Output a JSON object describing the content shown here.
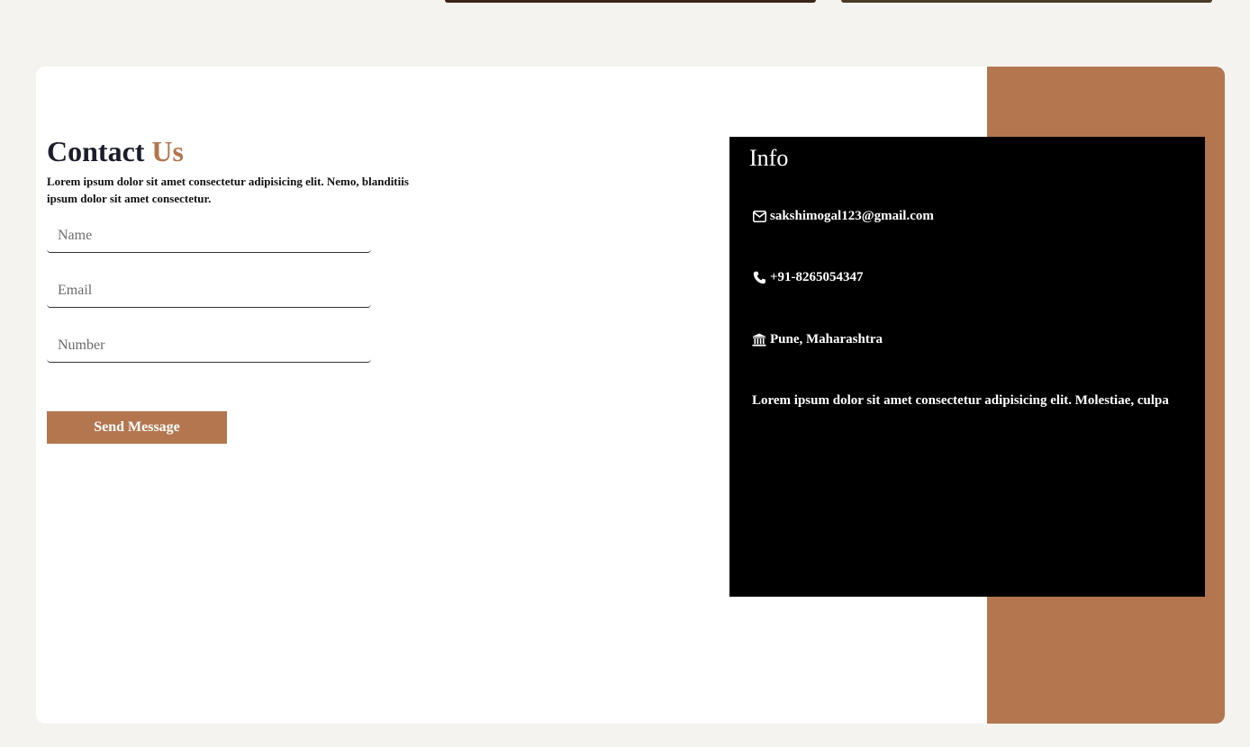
{
  "contact": {
    "title_main": "Contact",
    "title_accent": "Us",
    "subtitle": "Lorem ipsum dolor sit amet consectetur adipisicing elit. Nemo, blanditiis ipsum dolor sit amet consectetur.",
    "name_placeholder": "Name",
    "email_placeholder": "Email",
    "number_placeholder": "Number",
    "send_label": "Send Message"
  },
  "info": {
    "title": "Info",
    "email": "sakshimogal123@gmail.com",
    "phone": "+91-8265054347",
    "location": "Pune, Maharashtra",
    "description": "Lorem ipsum dolor sit amet consectetur adipisicing elit. Molestiae, culpa"
  },
  "icons": {
    "email": "envelope-icon",
    "phone": "phone-icon",
    "location": "building-icon"
  },
  "colors": {
    "accent": "#b3764f",
    "page_bg": "#f4f3ef",
    "title": "#1b1e2a",
    "info_bg": "#000000"
  }
}
